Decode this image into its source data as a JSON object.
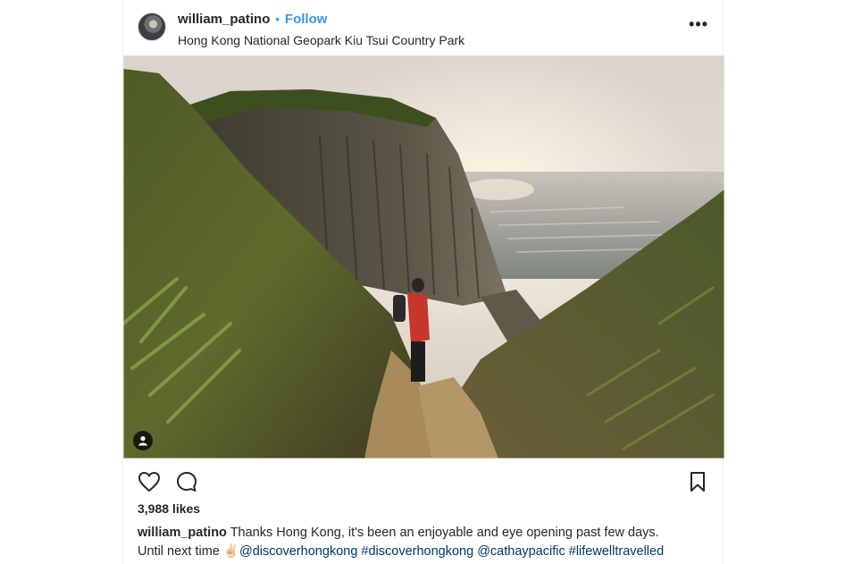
{
  "post": {
    "username": "william_patino",
    "separator": "•",
    "follow_label": "Follow",
    "location": "Hong Kong National Geopark Kiu Tsui Country Park",
    "more_label": "•••"
  },
  "actions": {
    "icons": [
      "heart-icon",
      "comment-icon",
      "bookmark-icon"
    ]
  },
  "likes": "3,988 likes",
  "caption": {
    "username": "william_patino",
    "line1": " Thanks Hong Kong, it's been an enjoyable and eye opening past few days.",
    "line2_prefix": "Until next time ",
    "emoji": "✌🏻",
    "hashtags": "@discoverhongkong #discoverhongkong @cathaypacific #lifewelltravelled"
  },
  "colors": {
    "accent": "#3897f0",
    "link": "#003569",
    "text": "#262626"
  }
}
